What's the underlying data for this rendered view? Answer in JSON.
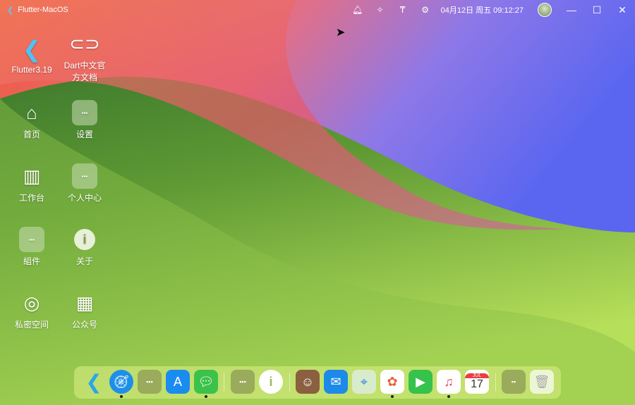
{
  "titlebar": {
    "app_title": "Flutter-MacOS",
    "datetime": "04月12日 周五 09:12:27",
    "icons": [
      "bell-icon",
      "magic-wand-icon",
      "pin-icon",
      "gear-icon"
    ],
    "minimize": "—",
    "maximize": "☐",
    "close": "✕"
  },
  "desktop": [
    {
      "label": "Flutter3.19",
      "icon": "flutter-logo"
    },
    {
      "label": "Dart中文官方文档",
      "icon": "link-icon"
    },
    {
      "label": "首页",
      "icon": "home-icon"
    },
    {
      "label": "设置",
      "icon": "folder-icon"
    },
    {
      "label": "工作台",
      "icon": "chart-icon"
    },
    {
      "label": "个人中心",
      "icon": "folder-icon"
    },
    {
      "label": "組件",
      "icon": "folder-icon"
    },
    {
      "label": "关于",
      "icon": "info-icon"
    },
    {
      "label": "私密空间",
      "icon": "aperture-icon"
    },
    {
      "label": "公众号",
      "icon": "qrcode-icon"
    }
  ],
  "dock": {
    "calendar_month": "JUL",
    "calendar_day": "17",
    "items": [
      "flutter",
      "safari",
      "folder",
      "app-store",
      "messages",
      "folder",
      "info",
      "contacts",
      "mail",
      "maps",
      "photos",
      "facetime",
      "music",
      "calendar",
      "folder",
      "trash"
    ]
  }
}
